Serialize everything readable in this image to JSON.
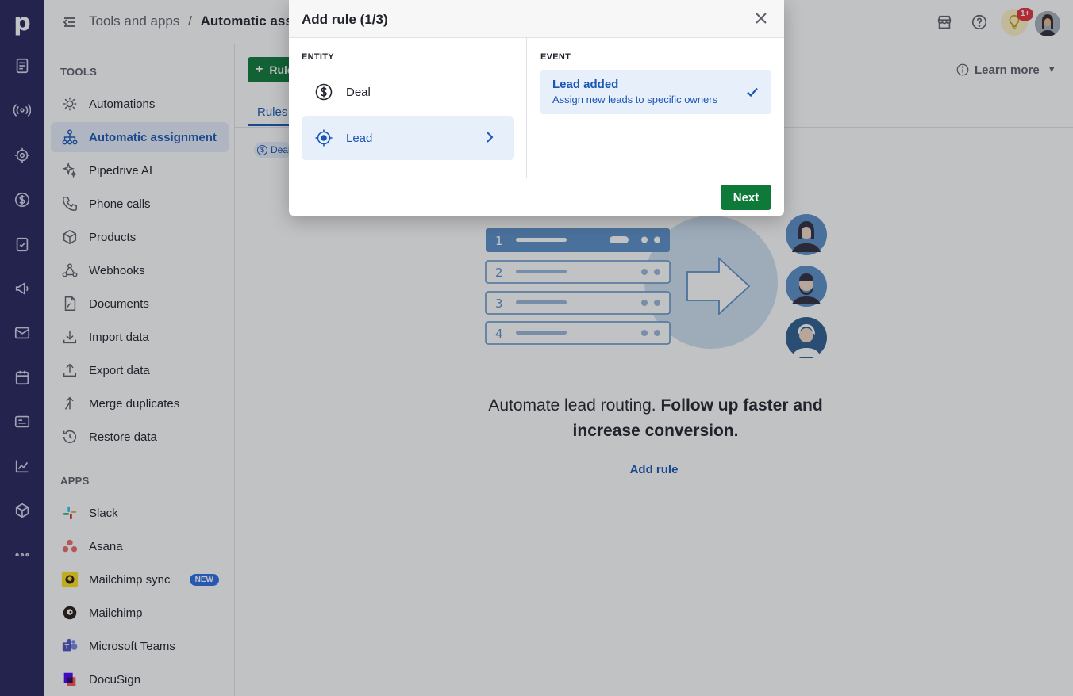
{
  "topbar": {
    "breadcrumb_parent": "Tools and apps",
    "breadcrumb_sep": "/",
    "breadcrumb_current": "Automatic assignment",
    "notification_count": "1+"
  },
  "rail": {
    "logo": "p",
    "icons": [
      "leads-icon",
      "radar-icon",
      "target-icon",
      "deals-icon",
      "tasks-icon",
      "campaigns-icon",
      "mail-icon",
      "calendar-icon",
      "contacts-icon",
      "insights-icon",
      "products-icon",
      "more-icon"
    ]
  },
  "sidebar": {
    "tools_header": "TOOLS",
    "tools": [
      {
        "label": "Automations"
      },
      {
        "label": "Automatic assignment"
      },
      {
        "label": "Pipedrive AI"
      },
      {
        "label": "Phone calls"
      },
      {
        "label": "Products"
      },
      {
        "label": "Webhooks"
      },
      {
        "label": "Documents"
      },
      {
        "label": "Import data"
      },
      {
        "label": "Export data"
      },
      {
        "label": "Merge duplicates"
      },
      {
        "label": "Restore data"
      }
    ],
    "apps_header": "APPS",
    "apps": [
      {
        "label": "Slack"
      },
      {
        "label": "Asana"
      },
      {
        "label": "Mailchimp sync",
        "badge": "NEW"
      },
      {
        "label": "Mailchimp"
      },
      {
        "label": "Microsoft Teams"
      },
      {
        "label": "DocuSign"
      }
    ]
  },
  "main": {
    "add_button": "Rule",
    "tab": "Rules",
    "chip": "Deal",
    "learn_more": "Learn more",
    "empty_text_normal": "Automate lead routing.",
    "empty_text_bold": "Follow up faster and increase conversion.",
    "empty_link": "Add rule",
    "illus_rows": [
      "1",
      "2",
      "3",
      "4"
    ]
  },
  "modal": {
    "title": "Add rule (1/3)",
    "entity_label": "ENTITY",
    "event_label": "EVENT",
    "entities": [
      {
        "label": "Deal"
      },
      {
        "label": "Lead"
      }
    ],
    "event_title": "Lead added",
    "event_desc": "Assign new leads to specific owners",
    "next": "Next"
  },
  "colors": {
    "rail": "#26235a",
    "accent": "#1a57b5",
    "primary_button": "#0d7a3a",
    "selected_bg": "#e7effb"
  }
}
